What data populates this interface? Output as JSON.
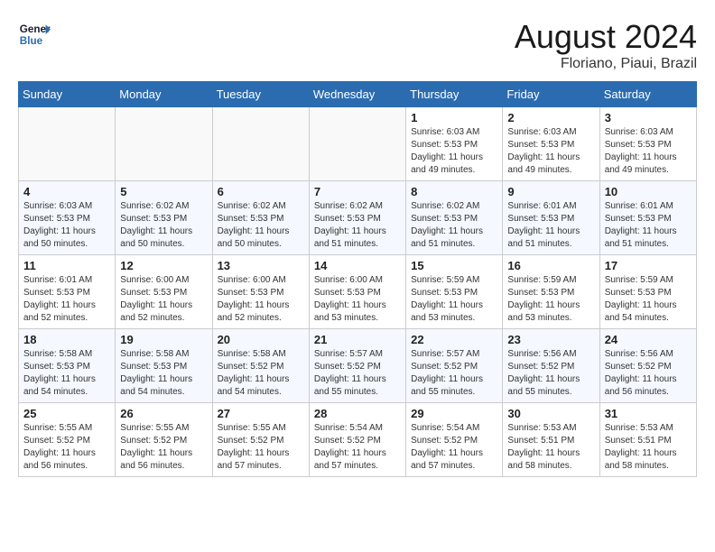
{
  "header": {
    "logo_line1": "General",
    "logo_line2": "Blue",
    "month_year": "August 2024",
    "location": "Floriano, Piaui, Brazil"
  },
  "weekdays": [
    "Sunday",
    "Monday",
    "Tuesday",
    "Wednesday",
    "Thursday",
    "Friday",
    "Saturday"
  ],
  "weeks": [
    [
      {
        "day": "",
        "empty": true
      },
      {
        "day": "",
        "empty": true
      },
      {
        "day": "",
        "empty": true
      },
      {
        "day": "",
        "empty": true
      },
      {
        "day": "1",
        "sunrise": "6:03 AM",
        "sunset": "5:53 PM",
        "daylight": "11 hours and 49 minutes."
      },
      {
        "day": "2",
        "sunrise": "6:03 AM",
        "sunset": "5:53 PM",
        "daylight": "11 hours and 49 minutes."
      },
      {
        "day": "3",
        "sunrise": "6:03 AM",
        "sunset": "5:53 PM",
        "daylight": "11 hours and 49 minutes."
      }
    ],
    [
      {
        "day": "4",
        "sunrise": "6:03 AM",
        "sunset": "5:53 PM",
        "daylight": "11 hours and 50 minutes."
      },
      {
        "day": "5",
        "sunrise": "6:02 AM",
        "sunset": "5:53 PM",
        "daylight": "11 hours and 50 minutes."
      },
      {
        "day": "6",
        "sunrise": "6:02 AM",
        "sunset": "5:53 PM",
        "daylight": "11 hours and 50 minutes."
      },
      {
        "day": "7",
        "sunrise": "6:02 AM",
        "sunset": "5:53 PM",
        "daylight": "11 hours and 51 minutes."
      },
      {
        "day": "8",
        "sunrise": "6:02 AM",
        "sunset": "5:53 PM",
        "daylight": "11 hours and 51 minutes."
      },
      {
        "day": "9",
        "sunrise": "6:01 AM",
        "sunset": "5:53 PM",
        "daylight": "11 hours and 51 minutes."
      },
      {
        "day": "10",
        "sunrise": "6:01 AM",
        "sunset": "5:53 PM",
        "daylight": "11 hours and 51 minutes."
      }
    ],
    [
      {
        "day": "11",
        "sunrise": "6:01 AM",
        "sunset": "5:53 PM",
        "daylight": "11 hours and 52 minutes."
      },
      {
        "day": "12",
        "sunrise": "6:00 AM",
        "sunset": "5:53 PM",
        "daylight": "11 hours and 52 minutes."
      },
      {
        "day": "13",
        "sunrise": "6:00 AM",
        "sunset": "5:53 PM",
        "daylight": "11 hours and 52 minutes."
      },
      {
        "day": "14",
        "sunrise": "6:00 AM",
        "sunset": "5:53 PM",
        "daylight": "11 hours and 53 minutes."
      },
      {
        "day": "15",
        "sunrise": "5:59 AM",
        "sunset": "5:53 PM",
        "daylight": "11 hours and 53 minutes."
      },
      {
        "day": "16",
        "sunrise": "5:59 AM",
        "sunset": "5:53 PM",
        "daylight": "11 hours and 53 minutes."
      },
      {
        "day": "17",
        "sunrise": "5:59 AM",
        "sunset": "5:53 PM",
        "daylight": "11 hours and 54 minutes."
      }
    ],
    [
      {
        "day": "18",
        "sunrise": "5:58 AM",
        "sunset": "5:53 PM",
        "daylight": "11 hours and 54 minutes."
      },
      {
        "day": "19",
        "sunrise": "5:58 AM",
        "sunset": "5:53 PM",
        "daylight": "11 hours and 54 minutes."
      },
      {
        "day": "20",
        "sunrise": "5:58 AM",
        "sunset": "5:52 PM",
        "daylight": "11 hours and 54 minutes."
      },
      {
        "day": "21",
        "sunrise": "5:57 AM",
        "sunset": "5:52 PM",
        "daylight": "11 hours and 55 minutes."
      },
      {
        "day": "22",
        "sunrise": "5:57 AM",
        "sunset": "5:52 PM",
        "daylight": "11 hours and 55 minutes."
      },
      {
        "day": "23",
        "sunrise": "5:56 AM",
        "sunset": "5:52 PM",
        "daylight": "11 hours and 55 minutes."
      },
      {
        "day": "24",
        "sunrise": "5:56 AM",
        "sunset": "5:52 PM",
        "daylight": "11 hours and 56 minutes."
      }
    ],
    [
      {
        "day": "25",
        "sunrise": "5:55 AM",
        "sunset": "5:52 PM",
        "daylight": "11 hours and 56 minutes."
      },
      {
        "day": "26",
        "sunrise": "5:55 AM",
        "sunset": "5:52 PM",
        "daylight": "11 hours and 56 minutes."
      },
      {
        "day": "27",
        "sunrise": "5:55 AM",
        "sunset": "5:52 PM",
        "daylight": "11 hours and 57 minutes."
      },
      {
        "day": "28",
        "sunrise": "5:54 AM",
        "sunset": "5:52 PM",
        "daylight": "11 hours and 57 minutes."
      },
      {
        "day": "29",
        "sunrise": "5:54 AM",
        "sunset": "5:52 PM",
        "daylight": "11 hours and 57 minutes."
      },
      {
        "day": "30",
        "sunrise": "5:53 AM",
        "sunset": "5:51 PM",
        "daylight": "11 hours and 58 minutes."
      },
      {
        "day": "31",
        "sunrise": "5:53 AM",
        "sunset": "5:51 PM",
        "daylight": "11 hours and 58 minutes."
      }
    ]
  ],
  "labels": {
    "sunrise": "Sunrise:",
    "sunset": "Sunset:",
    "daylight": "Daylight:"
  }
}
